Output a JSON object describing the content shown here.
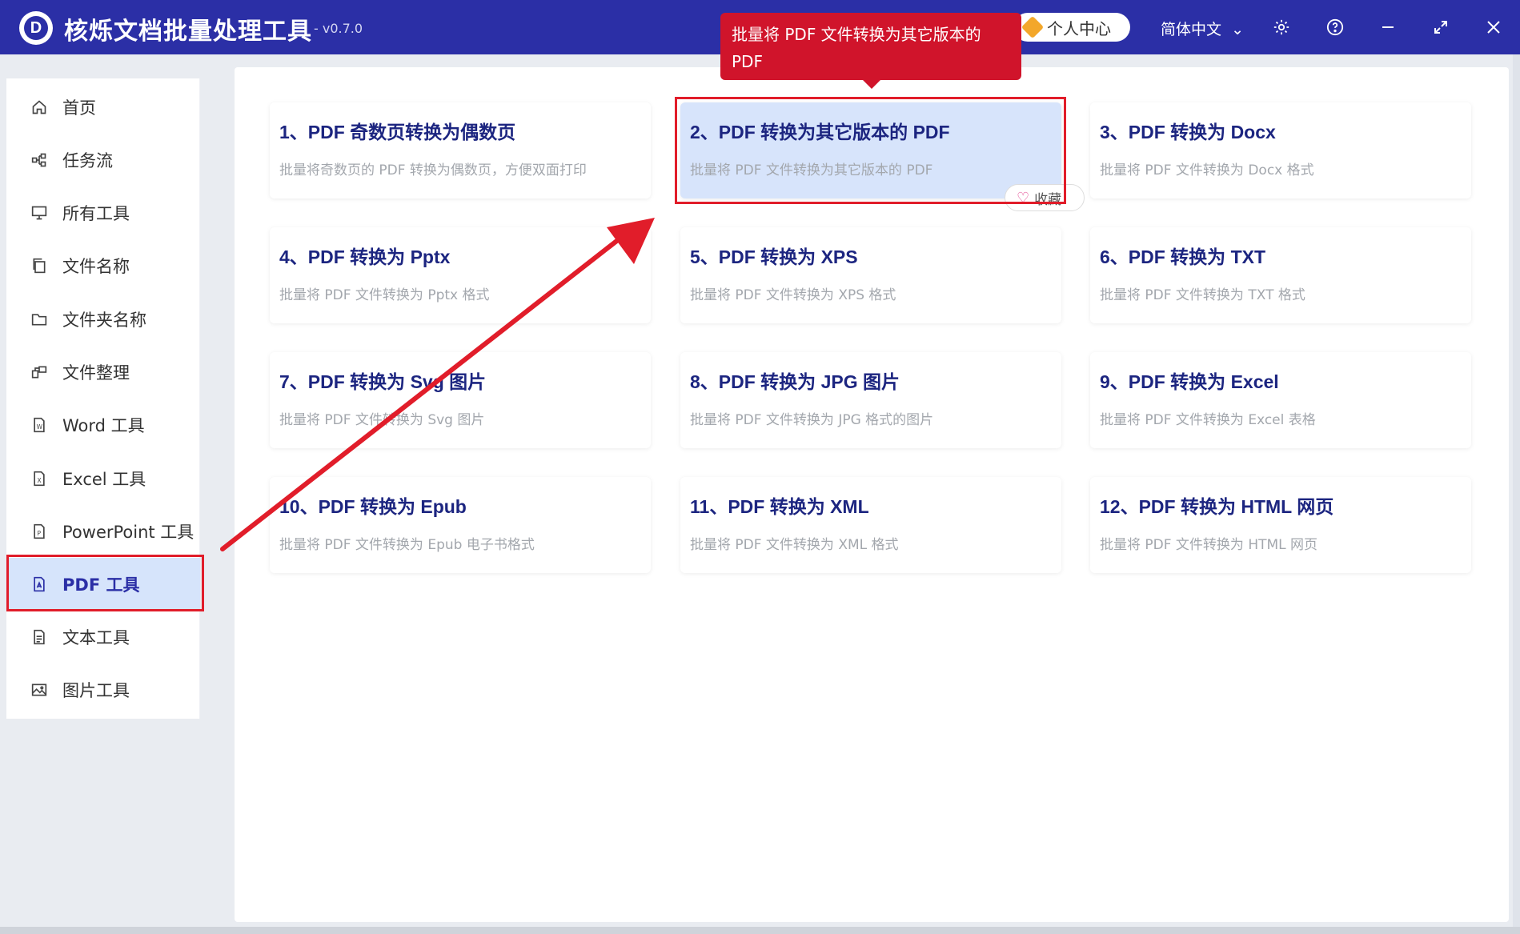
{
  "app": {
    "title": "核烁文档批量处理工具",
    "version": "- v0.7.0",
    "logo_letter": "D",
    "user_center": "个人中心",
    "language": "简体中文"
  },
  "titlebar_icons": [
    "settings-icon",
    "help-icon",
    "minimize-icon",
    "maximize-icon",
    "close-icon"
  ],
  "sidebar": {
    "items": [
      {
        "label": "首页",
        "icon": "home-icon"
      },
      {
        "label": "任务流",
        "icon": "workflow-icon"
      },
      {
        "label": "所有工具",
        "icon": "monitor-icon"
      },
      {
        "label": "文件名称",
        "icon": "file-copy-icon"
      },
      {
        "label": "文件夹名称",
        "icon": "folder-icon"
      },
      {
        "label": "文件整理",
        "icon": "organize-icon"
      },
      {
        "label": "Word 工具",
        "icon": "word-file-icon"
      },
      {
        "label": "Excel 工具",
        "icon": "excel-file-icon"
      },
      {
        "label": "PowerPoint 工具",
        "icon": "ppt-file-icon"
      },
      {
        "label": "PDF 工具",
        "icon": "pdf-file-icon",
        "active": true
      },
      {
        "label": "文本工具",
        "icon": "text-file-icon"
      },
      {
        "label": "图片工具",
        "icon": "image-icon"
      }
    ]
  },
  "tools": [
    {
      "title": "1、PDF 奇数页转换为偶数页",
      "desc": "批量将奇数页的 PDF 转换为偶数页，方便双面打印"
    },
    {
      "title": "2、PDF 转换为其它版本的 PDF",
      "desc": "批量将 PDF 文件转换为其它版本的 PDF",
      "hover": true
    },
    {
      "title": "3、PDF 转换为 Docx",
      "desc": "批量将 PDF 文件转换为 Docx 格式"
    },
    {
      "title": "4、PDF 转换为 Pptx",
      "desc": "批量将 PDF 文件转换为 Pptx 格式"
    },
    {
      "title": "5、PDF 转换为 XPS",
      "desc": "批量将 PDF 文件转换为 XPS 格式"
    },
    {
      "title": "6、PDF 转换为 TXT",
      "desc": "批量将 PDF 文件转换为 TXT 格式"
    },
    {
      "title": "7、PDF 转换为 Svg 图片",
      "desc": "批量将 PDF 文件转换为 Svg 图片"
    },
    {
      "title": "8、PDF 转换为 JPG 图片",
      "desc": "批量将 PDF 文件转换为 JPG 格式的图片"
    },
    {
      "title": "9、PDF 转换为 Excel",
      "desc": "批量将 PDF 文件转换为 Excel 表格"
    },
    {
      "title": "10、PDF 转换为 Epub",
      "desc": "批量将 PDF 文件转换为 Epub 电子书格式"
    },
    {
      "title": "11、PDF 转换为 XML",
      "desc": "批量将 PDF 文件转换为 XML 格式"
    },
    {
      "title": "12、PDF 转换为 HTML 网页",
      "desc": "批量将 PDF 文件转换为 HTML 网页"
    }
  ],
  "favorite_label": "收藏",
  "tooltip": "批量将 PDF 文件转换为其它版本的 PDF",
  "colors": {
    "titlebar": "#2b2fa6",
    "active_bg": "#d6e4fb",
    "highlight": "#e11d2a",
    "card_title": "#1c2580"
  }
}
